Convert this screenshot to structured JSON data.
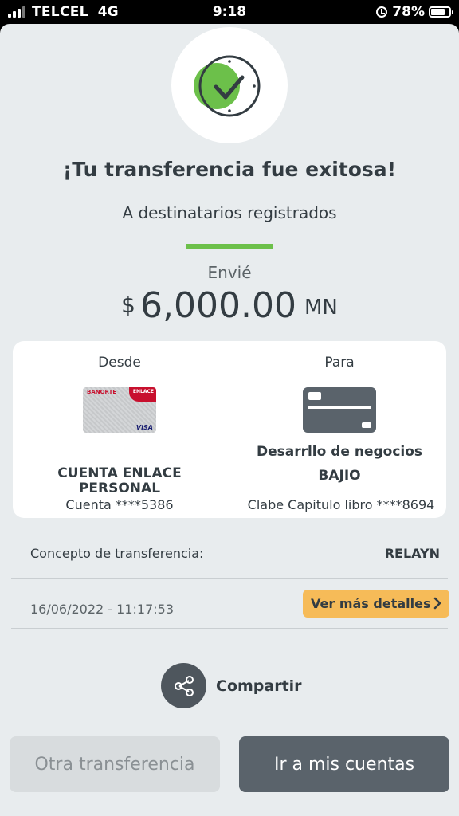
{
  "status_bar": {
    "carrier": "TELCEL",
    "network": "4G",
    "time": "9:18",
    "battery": "78%"
  },
  "receipt": {
    "title": "¡Tu transferencia fue exitosa!",
    "subtitle": "A destinatarios registrados",
    "sent_label": "Envié",
    "currency_symbol": "$",
    "amount": "6,000.00",
    "currency_code": "MN"
  },
  "accounts": {
    "from_label": "Desde",
    "to_label": "Para",
    "from_card": {
      "bank": "BANORTE",
      "tab": "ENLACE",
      "network": "VISA"
    },
    "from_name_line1": "CUENTA ENLACE",
    "from_name_line2": "PERSONAL",
    "from_number": "Cuenta ****5386",
    "to_name_line1": "Desarrllo de negocios",
    "to_name_line2": "BAJIO",
    "to_clabe": "Clabe Capitulo libro ****8694"
  },
  "details": {
    "concept_label": "Concepto de transferencia:",
    "concept_value": "RELAYN",
    "datetime": "16/06/2022 - 11:17:53",
    "more_details_button": "Ver más detalles"
  },
  "actions": {
    "share_label": "Compartir",
    "other_transfer_button": "Otra transferencia",
    "my_accounts_button": "Ir a mis cuentas"
  },
  "colors": {
    "accent_green": "#6cc04a",
    "details_yellow": "#f6bb58",
    "primary_dark": "#5a636b",
    "background": "#e8ecee"
  }
}
